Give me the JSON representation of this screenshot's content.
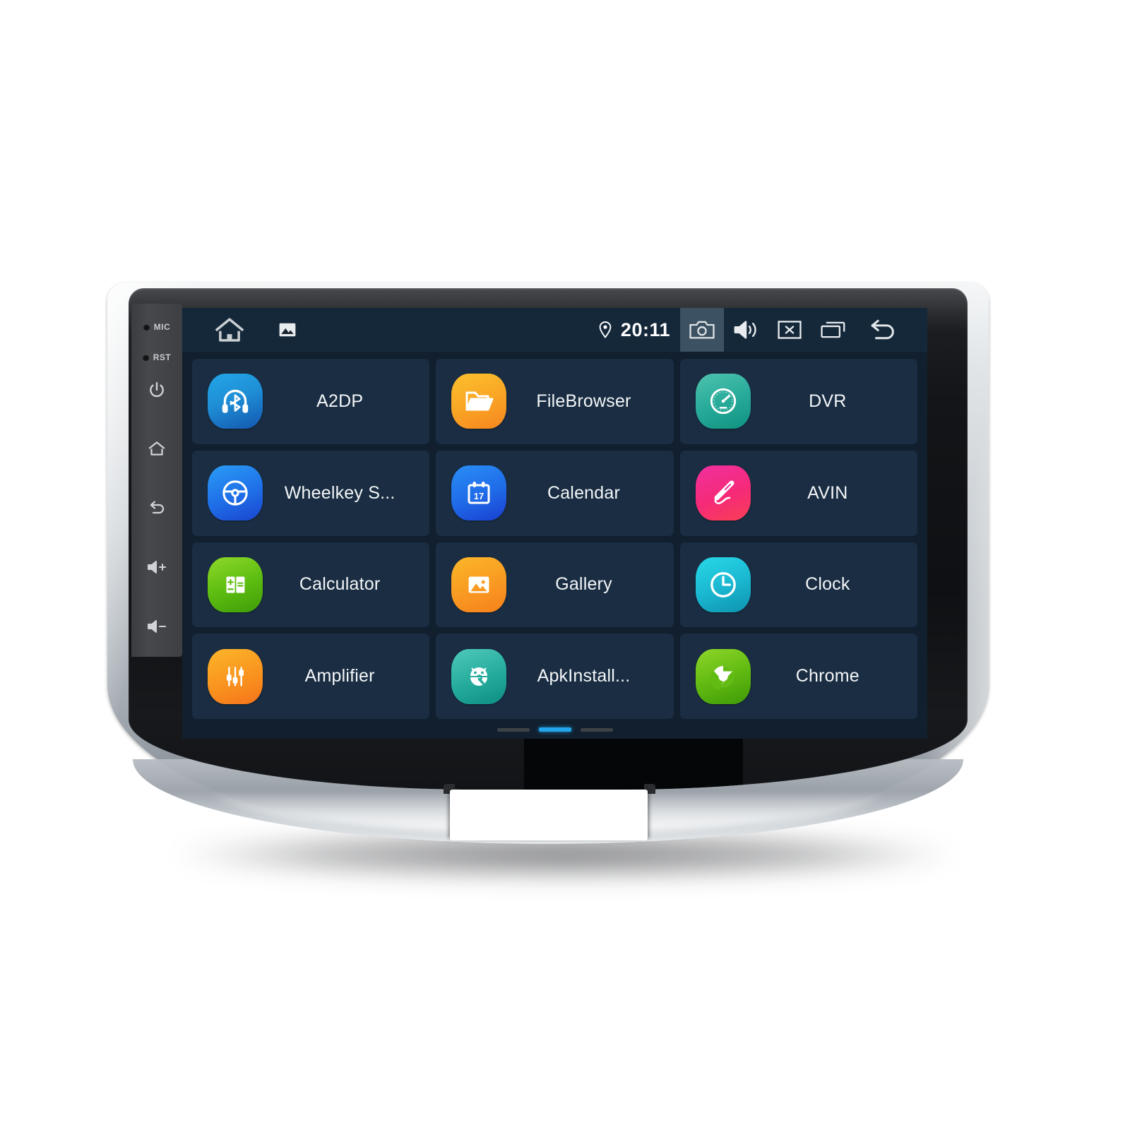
{
  "device": {
    "name": "car-head-unit",
    "hardkeys": [
      {
        "name": "mic-indicator",
        "label": "MIC",
        "icon": "dot-indicator"
      },
      {
        "name": "reset-indicator",
        "label": "RST",
        "icon": "dot-indicator"
      },
      {
        "name": "power-key",
        "label": "",
        "icon": "power-icon"
      },
      {
        "name": "home-key",
        "label": "",
        "icon": "home-icon"
      },
      {
        "name": "back-key",
        "label": "",
        "icon": "back-arrow-icon"
      },
      {
        "name": "volume-up-key",
        "label": "",
        "icon": "volume-up-icon"
      },
      {
        "name": "volume-down-key",
        "label": "",
        "icon": "volume-down-icon"
      }
    ]
  },
  "statusbar": {
    "home_icon": "home-icon",
    "gallery_icon": "image-icon",
    "location_icon": "location-pin-icon",
    "clock": "20:11",
    "camera_icon": "camera-icon",
    "camera_active": true,
    "volume_icon": "volume-icon",
    "close_icon": "close-box-icon",
    "recents_icon": "recent-apps-icon",
    "back_icon": "back-arrow-icon",
    "bar_color": "#15283a",
    "active_highlight": "#3c5161"
  },
  "screen": {
    "background": "#111f2e",
    "tile_color": "#1a2d42",
    "accent": "#22a5ea"
  },
  "apps": [
    {
      "label": "A2DP",
      "icon": "bluetooth-headphones-icon",
      "theme": "g-a2dp"
    },
    {
      "label": "FileBrowser",
      "icon": "folder-icon",
      "theme": "g-file"
    },
    {
      "label": "DVR",
      "icon": "gauge-icon",
      "theme": "g-dvr"
    },
    {
      "label": "Wheelkey S...",
      "icon": "steering-wheel-icon",
      "theme": "g-wheel"
    },
    {
      "label": "Calendar",
      "icon": "calendar-icon",
      "theme": "g-cal",
      "badge": "17"
    },
    {
      "label": "AVIN",
      "icon": "audio-jack-icon",
      "theme": "g-avin"
    },
    {
      "label": "Calculator",
      "icon": "calculator-icon",
      "theme": "g-calc"
    },
    {
      "label": "Gallery",
      "icon": "image-icon",
      "theme": "g-gal"
    },
    {
      "label": "Clock",
      "icon": "clock-icon",
      "theme": "g-clock"
    },
    {
      "label": "Amplifier",
      "icon": "equalizer-icon",
      "theme": "g-amp"
    },
    {
      "label": "ApkInstall...",
      "icon": "android-wrench-icon",
      "theme": "g-apk"
    },
    {
      "label": "Chrome",
      "icon": "chrome-icon",
      "theme": "g-chr"
    }
  ],
  "pager": {
    "count": 3,
    "active_index": 1
  }
}
